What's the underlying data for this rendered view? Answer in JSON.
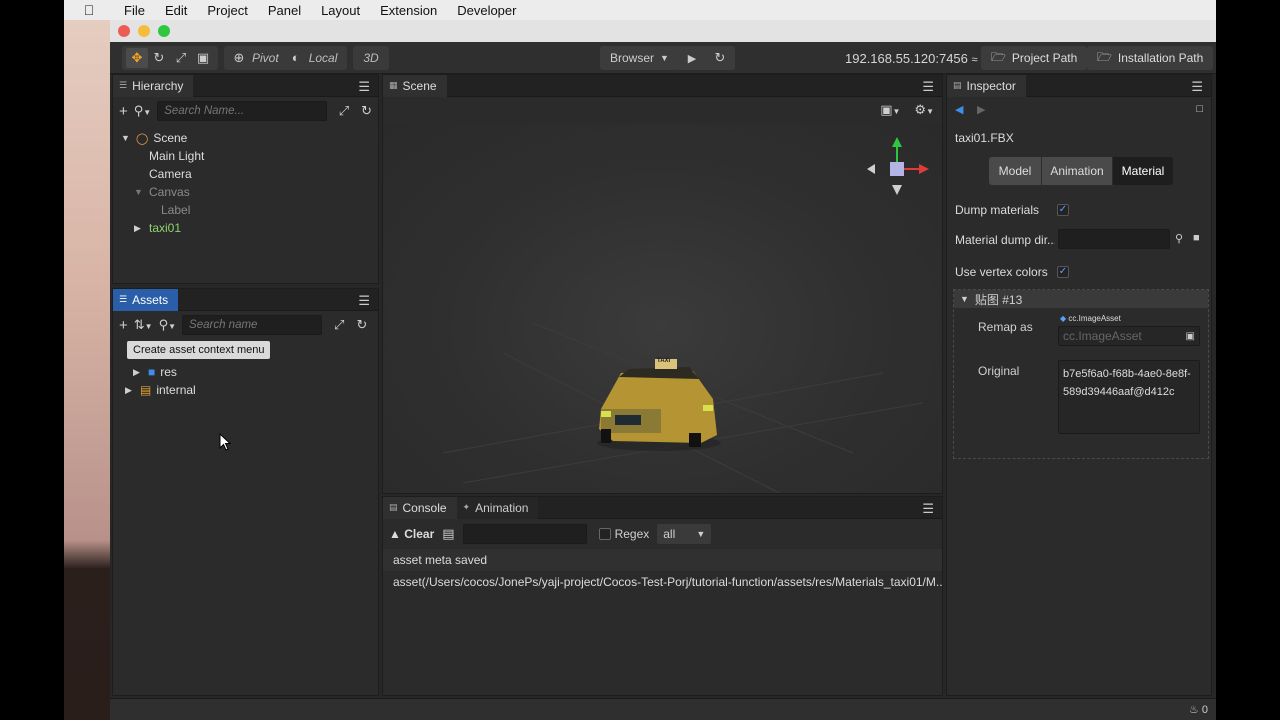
{
  "menubar": {
    "items": [
      "File",
      "Edit",
      "Project",
      "Panel",
      "Layout",
      "Extension",
      "Developer"
    ]
  },
  "toolbar": {
    "pivot_label": "Pivot",
    "local_label": "Local",
    "mode_3d": "3D",
    "browser_label": "Browser",
    "ip_address": "192.168.55.120:7456",
    "project_path_label": "Project Path",
    "installation_path_label": "Installation Path"
  },
  "hierarchy": {
    "title": "Hierarchy",
    "search_placeholder": "Search Name...",
    "nodes": [
      {
        "label": "Scene"
      },
      {
        "label": "Main Light"
      },
      {
        "label": "Camera"
      },
      {
        "label": "Canvas"
      },
      {
        "label": "Label"
      },
      {
        "label": "taxi01"
      }
    ]
  },
  "assets": {
    "title": "Assets",
    "search_placeholder": "Search name",
    "tooltip": "Create asset context menu",
    "items": [
      {
        "label": "res"
      },
      {
        "label": "internal"
      }
    ]
  },
  "scene": {
    "title": "Scene",
    "taxi_sign": "TAXI"
  },
  "console": {
    "tab_console": "Console",
    "tab_animation": "Animation",
    "clear_label": "Clear",
    "regex_label": "Regex",
    "filter_value": "all",
    "logs": [
      "asset meta saved",
      "asset(/Users/cocos/JonePs/yaji-project/Cocos-Test-Porj/tutorial-function/assets/res/Materials_taxi01/M..."
    ]
  },
  "inspector": {
    "title": "Inspector",
    "file_name": "taxi01.FBX",
    "tabs": [
      "Model",
      "Animation",
      "Material"
    ],
    "active_tab": "Material",
    "dump_materials_label": "Dump materials",
    "dump_materials_checked": true,
    "material_dump_dir_label": "Material dump dir...",
    "use_vertex_colors_label": "Use vertex colors",
    "use_vertex_colors_checked": true,
    "section_title": "贴图 #13",
    "remap_as_label": "Remap as",
    "remap_type_tag": "cc.ImageAsset",
    "remap_placeholder": "cc.ImageAsset",
    "original_label": "Original",
    "original_value": "b7e5f6a0-f68b-4ae0-8e8f-589d39446aaf@d412c"
  },
  "statusbar": {
    "notification_count": "0"
  },
  "colors": {
    "accent_orange": "#f6a623",
    "assets_tab_blue": "#2a5ea8",
    "green_node": "#8fd36b",
    "check_blue": "#5aa0ff"
  }
}
